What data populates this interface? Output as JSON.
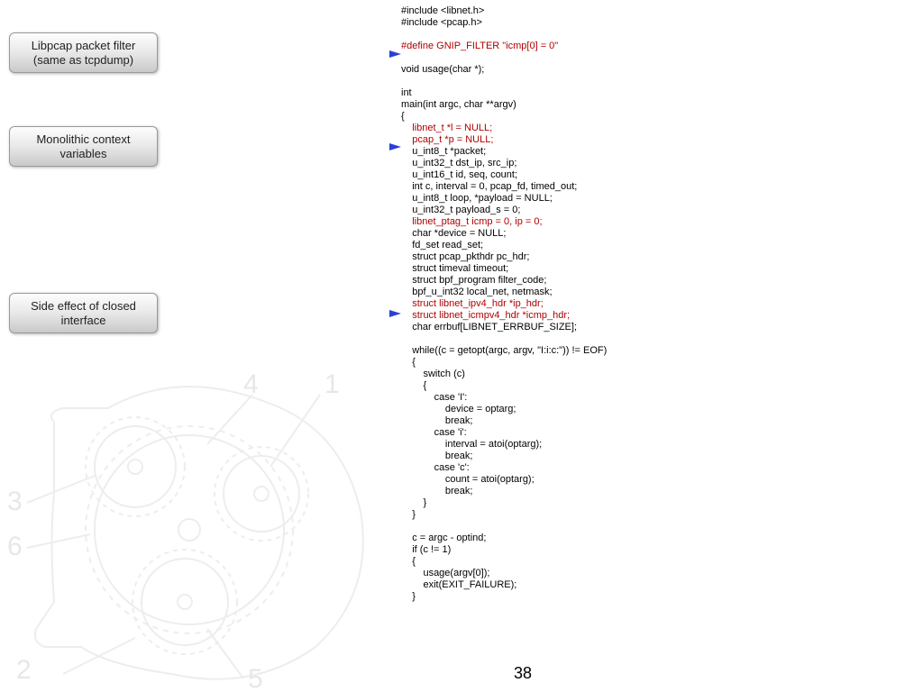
{
  "callouts": [
    {
      "line1": "Libpcap packet filter",
      "line2": "(same as tcpdump)"
    },
    {
      "line1": "Monolithic context",
      "line2": "variables"
    },
    {
      "line1": "Side effect of closed",
      "line2": "interface"
    }
  ],
  "code": {
    "l01": "#include <libnet.h>",
    "l02": "#include <pcap.h>",
    "l03": "#define GNIP_FILTER \"icmp[0] = 0\"",
    "l04": "void usage(char *);",
    "l05": "int",
    "l06": "main(int argc, char **argv)",
    "l07": "{",
    "l08": "    libnet_t *l = NULL;",
    "l09": "    pcap_t *p = NULL;",
    "l10": "    u_int8_t *packet;",
    "l11": "    u_int32_t dst_ip, src_ip;",
    "l12": "    u_int16_t id, seq, count;",
    "l13": "    int c, interval = 0, pcap_fd, timed_out;",
    "l14": "    u_int8_t loop, *payload = NULL;",
    "l15": "    u_int32_t payload_s = 0;",
    "l16": "    libnet_ptag_t icmp = 0, ip = 0;",
    "l17": "    char *device = NULL;",
    "l18": "    fd_set read_set;",
    "l19": "    struct pcap_pkthdr pc_hdr;",
    "l20": "    struct timeval timeout;",
    "l21": "    struct bpf_program filter_code;",
    "l22": "    bpf_u_int32 local_net, netmask;",
    "l23": "    struct libnet_ipv4_hdr *ip_hdr;",
    "l24": "    struct libnet_icmpv4_hdr *icmp_hdr;",
    "l25": "    char errbuf[LIBNET_ERRBUF_SIZE];",
    "l26": "    while((c = getopt(argc, argv, \"I:i:c:\")) != EOF)",
    "l27": "    {",
    "l28": "        switch (c)",
    "l29": "        {",
    "l30": "            case 'I':",
    "l31": "                device = optarg;",
    "l32": "                break;",
    "l33": "            case 'i':",
    "l34": "                interval = atoi(optarg);",
    "l35": "                break;",
    "l36": "            case 'c':",
    "l37": "                count = atoi(optarg);",
    "l38": "                break;",
    "l39": "        }",
    "l40": "    }",
    "l41": "    c = argc - optind;",
    "l42": "    if (c != 1)",
    "l43": "    {",
    "l44": "        usage(argv[0]);",
    "l45": "        exit(EXIT_FAILURE);",
    "l46": "    }"
  },
  "gear_labels": {
    "n1": "1",
    "n2": "2",
    "n3": "3",
    "n4": "4",
    "n5": "5",
    "n6": "6"
  },
  "page_number": "38"
}
